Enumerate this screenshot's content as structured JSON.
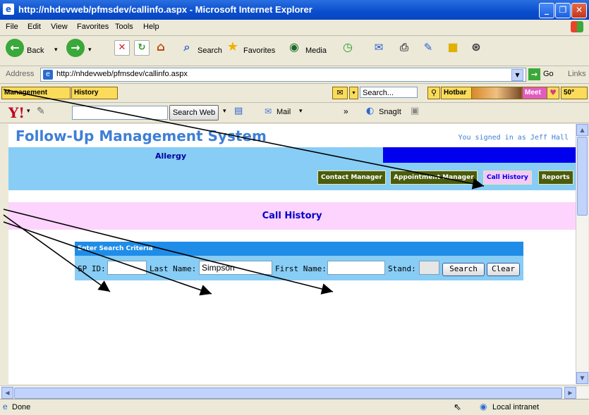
{
  "window": {
    "title": "http://nhdevweb/pfmsdev/callinfo.aspx - Microsoft Internet Explorer"
  },
  "menu": [
    "File",
    "Edit",
    "View",
    "Favorites",
    "Tools",
    "Help"
  ],
  "toolbar": {
    "back": "Back",
    "search": "Search",
    "favorites": "Favorites",
    "media": "Media"
  },
  "address": {
    "label": "Address",
    "url": "http://nhdevweb/pfmsdev/callinfo.aspx",
    "go": "Go",
    "links": "Links"
  },
  "links_bar": {
    "management": "Management",
    "history": "History",
    "search_placeholder": "Search...",
    "hotbar": "Hotbar",
    "meet": "Meet",
    "temp": "50°"
  },
  "yahoo_bar": {
    "logo": "Y!",
    "search_web": "Search Web",
    "mail": "Mail",
    "more": "»",
    "snagit": "SnagIt"
  },
  "app": {
    "title": "Follow-Up Management System",
    "signed_in": "You signed in as Jeff Hall",
    "department": "Allergy",
    "nav": [
      "Contact Manager",
      "Appointment Manager",
      "Call History",
      "Reports"
    ],
    "page_heading": "Call History"
  },
  "search": {
    "header": "Enter Search Criteria",
    "sp_id_label": "SP ID:",
    "sp_id_value": "",
    "last_name_label": "Last Name:",
    "last_name_value": "Simpson",
    "first_name_label": "First Name:",
    "first_name_value": "",
    "stand_label": "Stand:",
    "stand_value": "",
    "search_button": "Search",
    "clear_button": "Clear"
  },
  "status": {
    "left": "Done",
    "zone": "Local intranet"
  }
}
